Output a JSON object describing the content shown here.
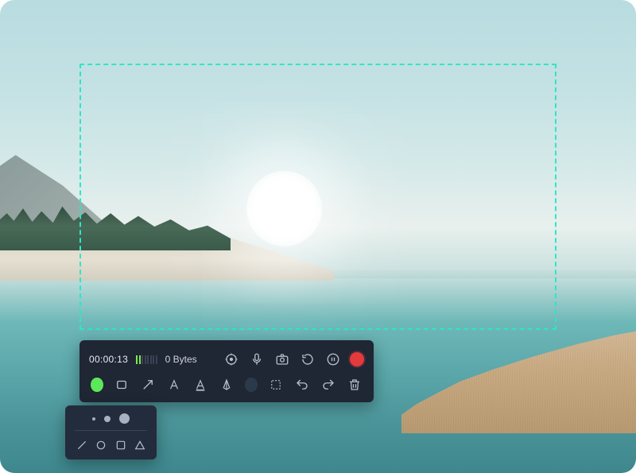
{
  "selection_color": "#2ee6c8",
  "recorder": {
    "timer": "00:00:13",
    "audio_level_bars": 8,
    "audio_level_active": 2,
    "size_label": "0 Bytes",
    "controls": {
      "cursor_icon": "cursor",
      "mic_icon": "microphone",
      "camera_icon": "camera",
      "restart_icon": "restart",
      "pause_icon": "pause",
      "record_icon": "record"
    }
  },
  "annotate": {
    "color_primary": "#5de85a",
    "color_secondary": "#2b3a4a",
    "tools": {
      "rect": "rectangle",
      "arrow": "arrow",
      "text": "text",
      "highlight": "highlighter",
      "pen": "pen",
      "marquee": "marquee",
      "undo": "undo",
      "redo": "redo",
      "trash": "trash"
    }
  },
  "brush_panel": {
    "sizes": [
      4,
      8,
      13
    ],
    "shapes": {
      "line": "line",
      "circle": "circle",
      "square": "square",
      "triangle": "triangle"
    }
  }
}
